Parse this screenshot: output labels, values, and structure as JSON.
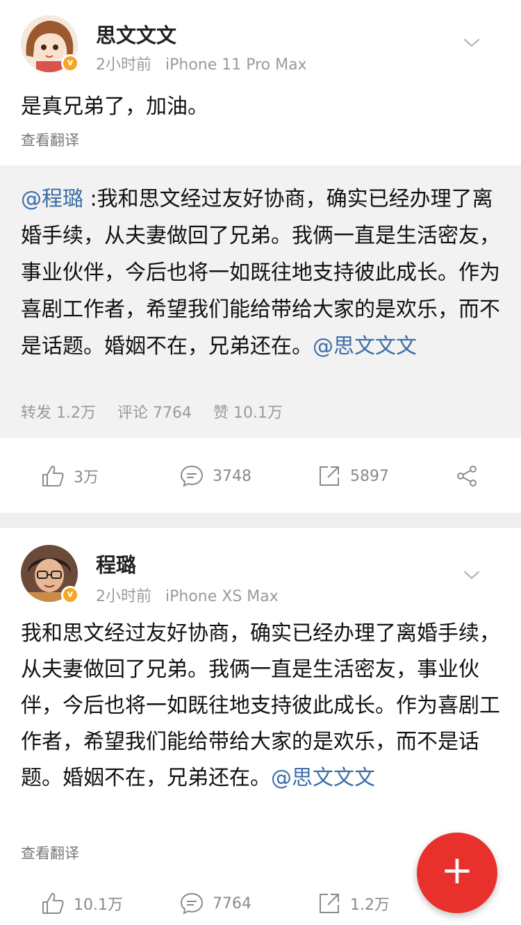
{
  "posts": [
    {
      "username": "思文文文",
      "time": "2小时前",
      "device": "iPhone 11 Pro Max",
      "text": "是真兄弟了，加油。",
      "translate": "查看翻译",
      "repost": {
        "mention": "@程璐",
        "text": " :我和思文经过友好协商，确实已经办理了离婚手续，从夫妻做回了兄弟。我俩一直是生活密友，事业伙伴，今后也将一如既往地支持彼此成长。作为喜剧工作者，希望我们能给带给大家的是欢乐，而不是话题。婚姻不在，兄弟还在。",
        "tail_mention": "@思文文文",
        "stats": {
          "reposts": "转发 1.2万",
          "comments": "评论 7764",
          "likes": "赞 10.1万"
        }
      },
      "actions": {
        "likes": "3万",
        "comments": "3748",
        "shares": "5897"
      }
    },
    {
      "username": "程璐",
      "time": "2小时前",
      "device": "iPhone XS Max",
      "text": "我和思文经过友好协商，确实已经办理了离婚手续，从夫妻做回了兄弟。我俩一直是生活密友，事业伙伴，今后也将一如既往地支持彼此成长。作为喜剧工作者，希望我们能给带给大家的是欢乐，而不是话题。婚姻不在，兄弟还在。",
      "tail_mention": "@思文文文",
      "translate": "查看翻译",
      "actions": {
        "likes": "10.1万",
        "comments": "7764",
        "shares": "1.2万"
      }
    }
  ],
  "fab_label": "+",
  "colors": {
    "mention": "#3b6da6",
    "fab": "#e8312d",
    "verified": "#f5a623"
  }
}
